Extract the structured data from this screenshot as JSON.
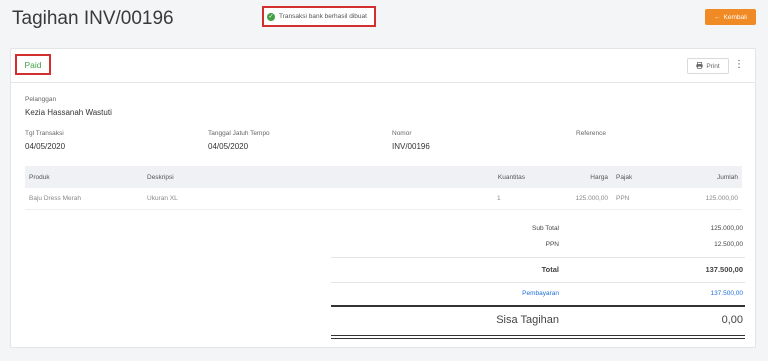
{
  "page": {
    "title": "Tagihan INV/00196"
  },
  "toast": {
    "text": "Transaksi bank berhasil dibuat",
    "icon": "check-circle-icon"
  },
  "header_actions": {
    "back_label": "Kembali",
    "back_icon": "arrow-left-icon",
    "accent": "#f08a24"
  },
  "card": {
    "status": "Paid",
    "status_color": "#43a047",
    "print_label": "Print",
    "print_icon": "printer-icon",
    "more_icon": "more-vertical-icon"
  },
  "info": {
    "customer_label": "Pelanggan",
    "customer_value": "Kezia Hassanah Wastuti",
    "date_label": "Tgl Transaksi",
    "date_value": "04/05/2020",
    "due_label": "Tanggal Jatuh Tempo",
    "due_value": "04/05/2020",
    "number_label": "Nomor",
    "number_value": "INV/00196",
    "reference_label": "Reference"
  },
  "table": {
    "headers": {
      "product": "Produk",
      "description": "Deskripsi",
      "quantity": "Kuantitas",
      "price": "Harga",
      "tax": "Pajak",
      "amount": "Jumlah"
    },
    "rows": [
      {
        "product": "Baju Dress Merah",
        "description": "Ukuran XL",
        "quantity": "1",
        "price": "125.000,00",
        "tax": "PPN",
        "amount": "125.000,00"
      }
    ]
  },
  "summary": {
    "subtotal_label": "Sub Total",
    "subtotal_value": "125.000,00",
    "tax_label": "PPN",
    "tax_value": "12.500,00",
    "total_label": "Total",
    "total_value": "137.500,00",
    "payment_label": "Pembayaran",
    "payment_value": "137.500,00",
    "balance_label": "Sisa Tagihan",
    "balance_value": "0,00",
    "link_color": "#1e6fd9"
  }
}
